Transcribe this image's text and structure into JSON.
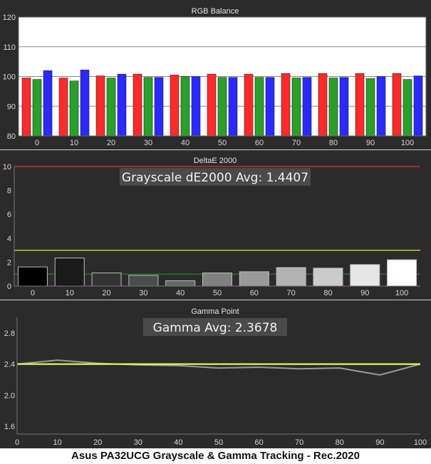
{
  "caption": "Asus PA32UCG Grayscale & Gamma Tracking - Rec.2020",
  "colors": {
    "red": "#ff2a2a",
    "green": "#2aa02a",
    "blue": "#2a2aff",
    "tolerance_yellow": "#e6e61a",
    "tolerance_green": "#1f8c1f",
    "limit_red": "#e03030",
    "gamma_target": "#f0f05a",
    "gamma_measured": "#9a9a9a"
  },
  "chart_data": [
    {
      "type": "bar",
      "title": "RGB Balance",
      "categories": [
        "0",
        "10",
        "20",
        "30",
        "40",
        "50",
        "60",
        "70",
        "80",
        "90",
        "100"
      ],
      "ylim": [
        80,
        120
      ],
      "yticks": [
        80,
        90,
        100,
        110,
        120
      ],
      "grid": true,
      "series": [
        {
          "color": "red",
          "values": [
            99.5,
            99.5,
            100.2,
            100.8,
            100.5,
            100.8,
            100.8,
            101.0,
            101.0,
            101.0,
            101.0
          ]
        },
        {
          "color": "green",
          "values": [
            99.0,
            98.5,
            99.5,
            99.7,
            100.0,
            99.7,
            99.7,
            99.5,
            99.5,
            99.3,
            99.0
          ]
        },
        {
          "color": "blue",
          "values": [
            102.0,
            102.2,
            100.8,
            99.7,
            100.0,
            99.7,
            99.7,
            99.7,
            99.7,
            100.0,
            100.2
          ]
        }
      ]
    },
    {
      "type": "bar",
      "title": "DeltaE 2000",
      "categories": [
        "0",
        "10",
        "20",
        "30",
        "40",
        "50",
        "60",
        "70",
        "80",
        "90",
        "100"
      ],
      "ylim": [
        0,
        10
      ],
      "yticks": [
        0,
        2,
        4,
        6,
        8,
        10
      ],
      "grid": false,
      "annotation": "Grayscale dE2000 Avg: 1.4407",
      "values": [
        1.6,
        2.35,
        1.1,
        0.9,
        0.45,
        1.1,
        1.2,
        1.55,
        1.5,
        1.8,
        2.2
      ],
      "reference_lines": [
        {
          "y": 3,
          "color": "tolerance_yellow"
        },
        {
          "y": 1,
          "color": "tolerance_green"
        },
        {
          "y": 10,
          "color": "limit_red"
        }
      ]
    },
    {
      "type": "line",
      "title": "Gamma Point",
      "x": [
        0,
        10,
        20,
        30,
        40,
        50,
        60,
        70,
        80,
        90,
        100
      ],
      "xlim": [
        0,
        100
      ],
      "ylim": [
        1.5,
        3.0
      ],
      "yticks": [
        1.6,
        2.0,
        2.4,
        2.8
      ],
      "xticks": [
        0,
        10,
        20,
        30,
        40,
        50,
        60,
        70,
        80,
        90,
        100
      ],
      "grid": false,
      "annotation": "Gamma Avg: 2.3678",
      "series": [
        {
          "color": "gamma_target",
          "values": [
            2.4,
            2.4,
            2.4,
            2.4,
            2.4,
            2.4,
            2.4,
            2.4,
            2.4,
            2.4,
            2.4
          ]
        },
        {
          "color": "gamma_measured",
          "values": [
            2.4,
            2.45,
            2.41,
            2.39,
            2.38,
            2.35,
            2.36,
            2.34,
            2.35,
            2.26,
            2.4
          ]
        }
      ]
    }
  ]
}
